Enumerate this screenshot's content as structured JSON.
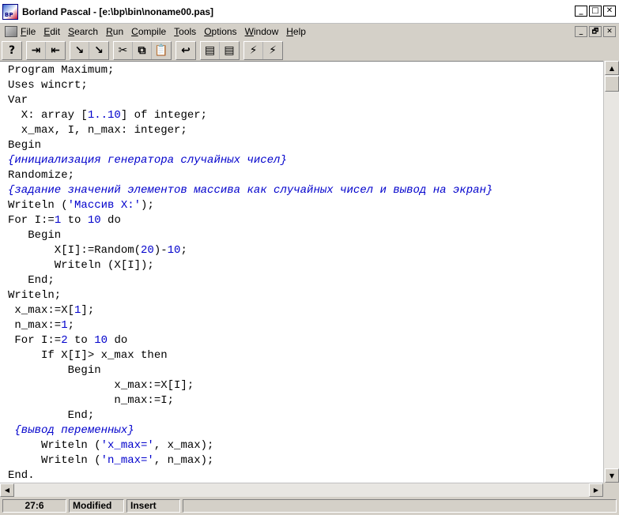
{
  "window": {
    "title": "Borland Pascal - [e:\\bp\\bin\\noname00.pas]",
    "controls": [
      "_",
      "□",
      "✕"
    ]
  },
  "menu": {
    "items": [
      "File",
      "Edit",
      "Search",
      "Run",
      "Compile",
      "Tools",
      "Options",
      "Window",
      "Help"
    ],
    "mdi_controls": [
      "_",
      "🗗",
      "✕"
    ]
  },
  "toolbar": {
    "groups": [
      [
        {
          "icon": "help-icon",
          "glyph": "?"
        }
      ],
      [
        {
          "icon": "step-over-icon",
          "glyph": "⇥"
        },
        {
          "icon": "trace-into-icon",
          "glyph": "⇤"
        }
      ],
      [
        {
          "icon": "run-to-cursor-icon",
          "glyph": "↘"
        },
        {
          "icon": "reset-program-icon",
          "glyph": "↘"
        }
      ],
      [
        {
          "icon": "cut-icon",
          "glyph": "✂"
        },
        {
          "icon": "copy-icon",
          "glyph": "⧉"
        },
        {
          "icon": "paste-icon",
          "glyph": "📋"
        }
      ],
      [
        {
          "icon": "undo-icon",
          "glyph": "↩"
        }
      ],
      [
        {
          "icon": "compile-icon",
          "glyph": "▤"
        },
        {
          "icon": "make-icon",
          "glyph": "▤"
        }
      ],
      [
        {
          "icon": "run-icon",
          "glyph": "⚡"
        },
        {
          "icon": "run-stop-icon",
          "glyph": "⚡"
        }
      ]
    ]
  },
  "code_lines": [
    [
      [
        "kw",
        "Program Maximum;"
      ]
    ],
    [
      [
        "kw",
        "Uses wincrt;"
      ]
    ],
    [
      [
        "kw",
        "Var"
      ]
    ],
    [
      [
        "kw",
        "  X: array ["
      ],
      [
        "num",
        "1..10"
      ],
      [
        "kw",
        "] of integer;"
      ]
    ],
    [
      [
        "kw",
        "  x_max, I, n_max: integer;"
      ]
    ],
    [
      [
        "kw",
        "Begin"
      ]
    ],
    [
      [
        "cm",
        "{инициализация генератора случайных чисел}"
      ]
    ],
    [
      [
        "kw",
        "Randomize;"
      ]
    ],
    [
      [
        "cm",
        "{задание значений элементов массива как случайных чисел и вывод на экран}"
      ]
    ],
    [
      [
        "kw",
        "Writeln ("
      ],
      [
        "str",
        "'Массив X:'"
      ],
      [
        "kw",
        ");"
      ]
    ],
    [
      [
        "kw",
        "For I:="
      ],
      [
        "num",
        "1"
      ],
      [
        "kw",
        " to "
      ],
      [
        "num",
        "10"
      ],
      [
        "kw",
        " do"
      ]
    ],
    [
      [
        "kw",
        "   Begin"
      ]
    ],
    [
      [
        "kw",
        "       X[I]:=Random("
      ],
      [
        "num",
        "20"
      ],
      [
        "kw",
        ")-"
      ],
      [
        "num",
        "10"
      ],
      [
        "kw",
        ";"
      ]
    ],
    [
      [
        "kw",
        "       Writeln (X[I]);"
      ]
    ],
    [
      [
        "kw",
        "   End;"
      ]
    ],
    [
      [
        "kw",
        "Writeln;"
      ]
    ],
    [
      [
        "kw",
        " x_max:=X["
      ],
      [
        "num",
        "1"
      ],
      [
        "kw",
        "];"
      ]
    ],
    [
      [
        "kw",
        " n_max:="
      ],
      [
        "num",
        "1"
      ],
      [
        "kw",
        ";"
      ]
    ],
    [
      [
        "kw",
        " For I:="
      ],
      [
        "num",
        "2"
      ],
      [
        "kw",
        " to "
      ],
      [
        "num",
        "10"
      ],
      [
        "kw",
        " do"
      ]
    ],
    [
      [
        "kw",
        "     If X[I]> x_max then"
      ]
    ],
    [
      [
        "kw",
        "         Begin"
      ]
    ],
    [
      [
        "kw",
        "                x_max:=X[I];"
      ]
    ],
    [
      [
        "kw",
        "                n_max:=I;"
      ]
    ],
    [
      [
        "kw",
        "         End;"
      ]
    ],
    [
      [
        "cm",
        " {вывод переменных}"
      ]
    ],
    [
      [
        "kw",
        "     Writeln ("
      ],
      [
        "str",
        "'x_max='"
      ],
      [
        "kw",
        ", x_max);"
      ]
    ],
    [
      [
        "kw",
        "     Writeln ("
      ],
      [
        "str",
        "'n_max='"
      ],
      [
        "kw",
        ", n_max);"
      ]
    ],
    [
      [
        "kw",
        "End."
      ]
    ]
  ],
  "status": {
    "position": "27:6",
    "modified": "Modified",
    "mode": "Insert"
  }
}
